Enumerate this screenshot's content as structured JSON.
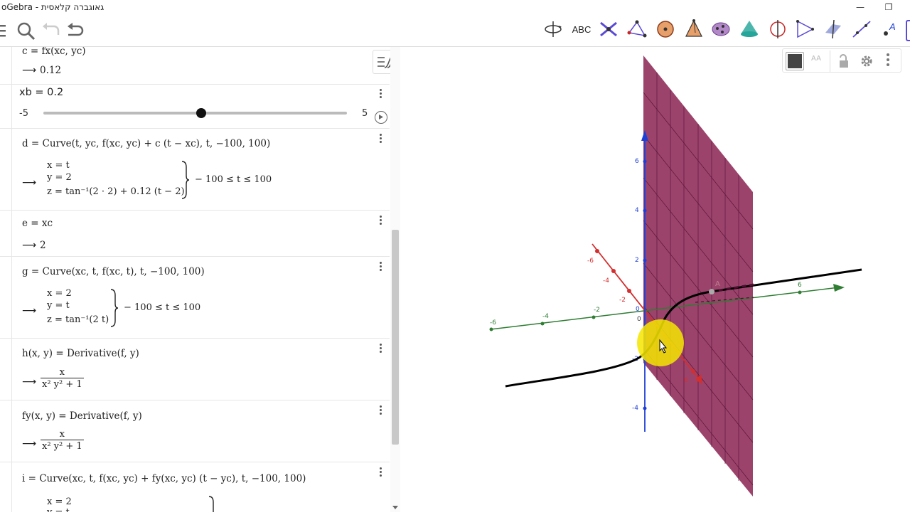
{
  "window": {
    "title": "oGebra - גאוגברה קלאסית",
    "min_symbol": "—",
    "restore_symbol": "❐"
  },
  "toolbar": {
    "tools": [
      {
        "name": "rotate-view-tool"
      },
      {
        "name": "text-tool",
        "label": "ABC"
      },
      {
        "name": "intersect-tool"
      },
      {
        "name": "polygon-tool"
      },
      {
        "name": "sphere-tool"
      },
      {
        "name": "pyramid-tool"
      },
      {
        "name": "net-tool"
      },
      {
        "name": "cone-tool"
      },
      {
        "name": "circle-axis-tool"
      },
      {
        "name": "angle-tool"
      },
      {
        "name": "plane-tool"
      },
      {
        "name": "line-tool"
      },
      {
        "name": "point-tool",
        "label": "A"
      }
    ]
  },
  "algebra": {
    "items": [
      {
        "def": "c  =  fx(xc, yc)",
        "output": "0.12"
      },
      {
        "def": "xb = 0.2",
        "slider_min": "-5",
        "slider_max": "5",
        "slider_value": 0.52
      },
      {
        "def": "d  =  Curve(t, yc, f(xc, yc) + c (t − xc), t, −100, 100)",
        "system": [
          "x = t",
          "y = 2",
          "z = tan⁻¹(2 · 2) + 0.12 (t − 2)"
        ],
        "range": "− 100 ≤ t ≤ 100"
      },
      {
        "def": "e  =  xc",
        "output": "2"
      },
      {
        "def": "g  =  Curve(xc, t, f(xc, t), t, −100, 100)",
        "system": [
          "x = 2",
          "y = t",
          "z = tan⁻¹(2 t)"
        ],
        "range": "− 100 ≤ t ≤ 100"
      },
      {
        "def": "h(x, y)  =  Derivative(f, y)",
        "num": "x",
        "den": "x² y² + 1"
      },
      {
        "def": "fy(x, y)  =  Derivative(f, y)",
        "num": "x",
        "den": "x² y² + 1"
      },
      {
        "def": "i  =  Curve(xc, t, f(xc, yc) + fy(xc, yc) (t − yc), t, −100, 100)",
        "system": [
          "x = 2",
          "y = t"
        ]
      }
    ],
    "arrow": "⟶"
  },
  "graphics": {
    "axis_ticks": {
      "z": [
        "6",
        "4",
        "2",
        "0",
        "-2",
        "-4"
      ],
      "y": [
        "-6",
        "-4",
        "-2",
        "6"
      ],
      "x": [
        "-6",
        "-4",
        "-2",
        "6"
      ],
      "origin": "0"
    },
    "point_label": "A",
    "colors": {
      "plane": "#8b2252",
      "x_axis": "#d32f2f",
      "y_axis": "#2e7d32",
      "z_axis": "#1e3fd6",
      "curve": "#000000",
      "highlight": "#f5e600"
    }
  }
}
